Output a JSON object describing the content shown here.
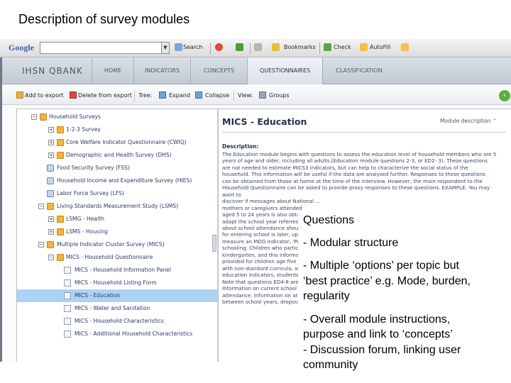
{
  "slide": {
    "title": "Description of survey modules"
  },
  "google_toolbar": {
    "logo": "Google",
    "search": "Search",
    "bookmarks": "Bookmarks",
    "check": "Check",
    "autofill": "AutoFill"
  },
  "app": {
    "logo": "IHSN QBANK",
    "tabs": [
      {
        "label": "HOME"
      },
      {
        "label": "INDICATORS"
      },
      {
        "label": "CONCEPTS"
      },
      {
        "label": "QUESTIONNAIRES"
      },
      {
        "label": "CLASSIFICATION"
      }
    ],
    "actions": {
      "add_to_export": "Add to export",
      "delete_from_export": "Delete from export",
      "tree_label": "Tree:",
      "expand": "Expand",
      "collapse": "Collapse",
      "view_label": "View:",
      "groups": "Groups"
    }
  },
  "tree": {
    "items": [
      {
        "label": "Household Surveys"
      },
      {
        "label": "1-2-3 Survey"
      },
      {
        "label": "Core Welfare Indicator Questionnaire (CWIQ)"
      },
      {
        "label": "Demographic and Health Survey (DHS)"
      },
      {
        "label": "Food Security Survey (FSS)"
      },
      {
        "label": "Household Income and Expenditure Survey (HIES)"
      },
      {
        "label": "Labor Force Survey (LFS)"
      },
      {
        "label": "Living Standards Measurement Study (LSMS)"
      },
      {
        "label": "LSMG - Health"
      },
      {
        "label": "LSMS - Housing"
      },
      {
        "label": "Multiple Indicator Cluster Survey (MICS)"
      },
      {
        "label": "MICS - Household Questionnaire"
      },
      {
        "label": "MICS - Household Information Panel"
      },
      {
        "label": "MICS - Household Listing Form"
      },
      {
        "label": "MICS - Education"
      },
      {
        "label": "MICS - Water and Sanitation"
      },
      {
        "label": "MICS - Household Characteristics"
      },
      {
        "label": "MICS - Additional Household Characteristics"
      }
    ]
  },
  "content": {
    "title": "MICS - Education",
    "module_description_link": "Module description",
    "description_label": "Description:",
    "description_lines": [
      "The Education module begins with questions to assess the education level of household members who are 5",
      "years of age and older, including all adults [Education module questions 2-3, or ED2- 3). These questions",
      "are not needed to estimate MICS3 indicators, but can help to characterize the social status of the",
      "household. This information will be useful if the data are analysed further. Responses to these questions",
      "can be obtained from those at home at the time of the interview. However, the main respondent to the",
      "Household Questionnaire can be asked to provide proxy responses to these questions. EXAMPLE: You may want to",
      "discover if messages about National ...",
      "mothers or caregivers attended",
      "aged 5 to 24 years is also obta",
      "adapt the school year referred",
      "about school attendance shoul",
      "for entering school is later, up",
      "measure an MDG indicator, 'Per",
      "schooling. Children who partici",
      "kindergarten, and this informati",
      "provided for children age five a",
      "with non-standard curricula, su",
      "education indicators, students",
      "Note that questions ED4-8 are",
      "Information on current school a",
      "attendance. Information on att",
      "between school years, dropout"
    ]
  },
  "overlay": {
    "lines": [
      "Questions",
      "- Modular structure",
      "- Multiple ‘options’ per topic but",
      "‘best practice’ e.g. Mode, burden,",
      "regularity",
      "- Overall module instructions,",
      "purpose and link to ‘concepts’",
      "- Discussion forum, linking user",
      "community"
    ]
  }
}
